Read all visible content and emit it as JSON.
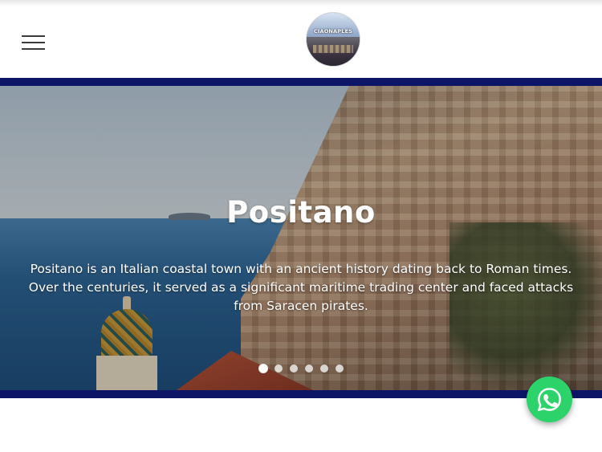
{
  "header": {
    "menu_icon": "hamburger-menu-icon",
    "logo_text": "CIAONAPLES"
  },
  "hero": {
    "title": "Positano",
    "description": "Positano is an Italian coastal town with an ancient history dating back to Roman times. Over the centuries, it served as a significant maritime trading center and faced attacks from Saracen pirates.",
    "slide_count": 6,
    "active_slide": 1
  },
  "floating": {
    "chat_icon": "whatsapp-icon"
  },
  "colors": {
    "navy_band": "#0d1566",
    "whatsapp_green": "#2bd36a",
    "header_bg": "#ffffff"
  }
}
